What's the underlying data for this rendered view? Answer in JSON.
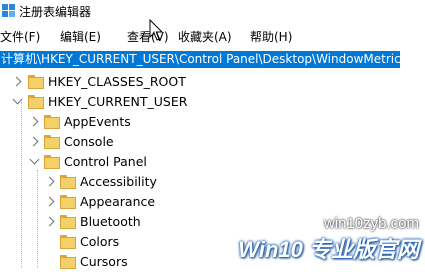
{
  "window": {
    "title": "注册表编辑器",
    "icon": "regedit-icon"
  },
  "menu": {
    "file": "文件(F)",
    "edit": "编辑(E)",
    "view": "查看(V)",
    "favorites": "收藏夹(A)",
    "help": "帮助(H)"
  },
  "address": {
    "path": "计算机\\HKEY_CURRENT_USER\\Control Panel\\Desktop\\WindowMetrics",
    "highlight_color": "#0078d7"
  },
  "tree": {
    "hkcr": "HKEY_CLASSES_ROOT",
    "hkcu": "HKEY_CURRENT_USER",
    "appevents": "AppEvents",
    "console": "Console",
    "control_panel": "Control Panel",
    "accessibility": "Accessibility",
    "appearance": "Appearance",
    "bluetooth": "Bluetooth",
    "colors": "Colors",
    "cursors": "Cursors"
  },
  "watermark": {
    "url": "win10zyb.com",
    "brand": "Win10 专业版官网"
  }
}
